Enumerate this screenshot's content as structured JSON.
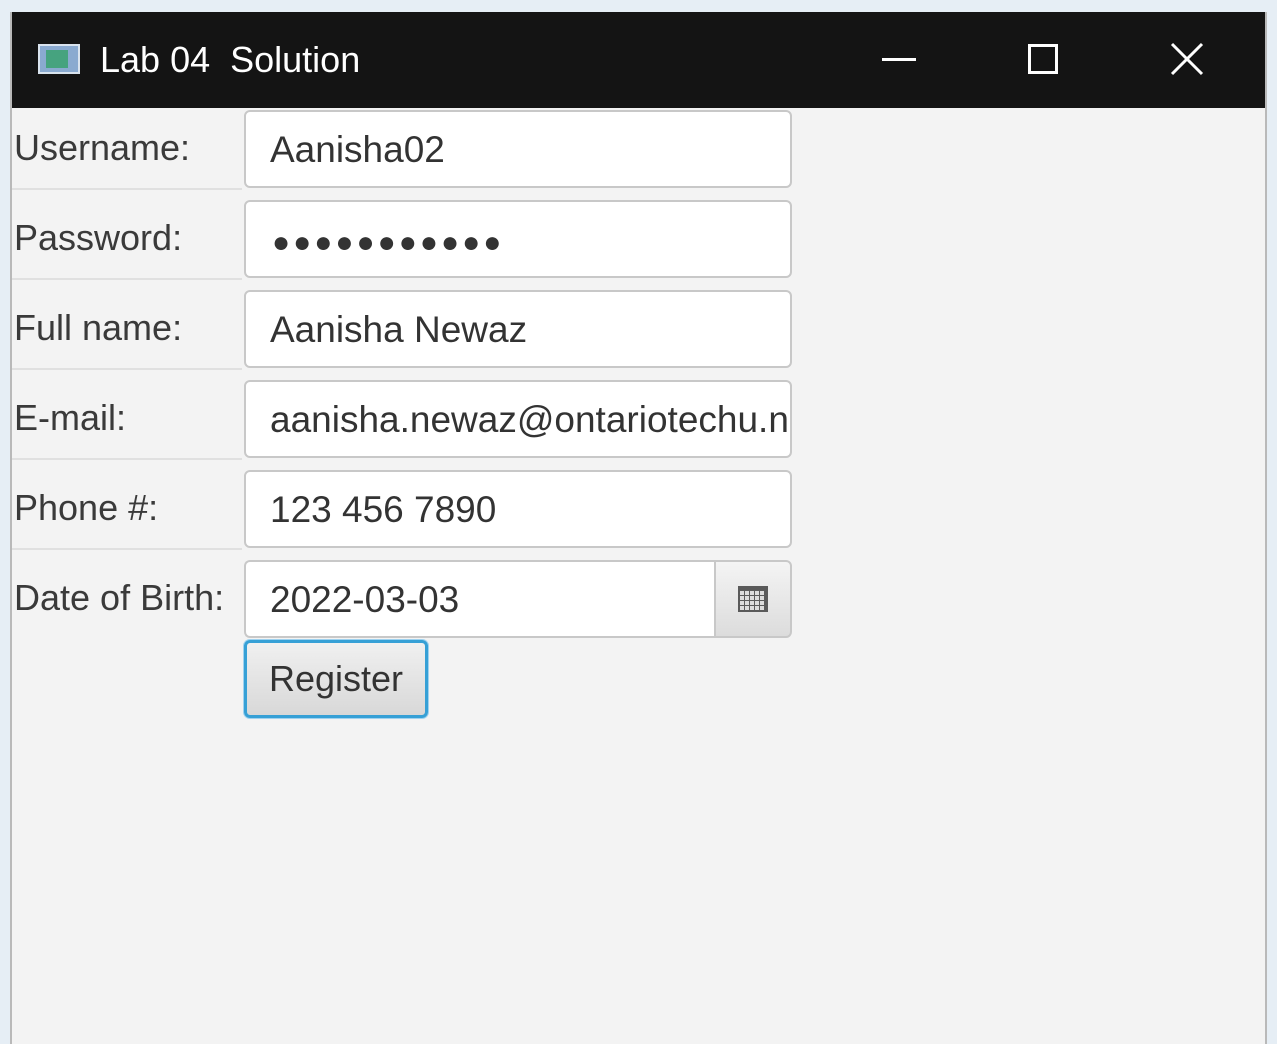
{
  "window": {
    "title": "Lab 04  Solution",
    "controls": {
      "minimize": "minimize-icon",
      "maximize": "maximize-icon",
      "close": "close-icon"
    }
  },
  "form": {
    "username": {
      "label": "Username:",
      "value": "Aanisha02"
    },
    "password": {
      "label": "Password:",
      "masked_value": "●●●●●●●●●●●"
    },
    "full_name": {
      "label": "Full name:",
      "value": "Aanisha Newaz"
    },
    "email": {
      "label": "E-mail:",
      "value": "aanisha.newaz@ontariotechu.net"
    },
    "phone": {
      "label": "Phone #:",
      "value": "123 456 7890"
    },
    "dob": {
      "label": "Date of Birth:",
      "value": "2022-03-03",
      "picker_icon": "calendar-icon"
    },
    "register_label": "Register"
  },
  "colors": {
    "titlebar": "#141414",
    "background": "#f3f3f3",
    "focus_border": "#36a0d6"
  }
}
